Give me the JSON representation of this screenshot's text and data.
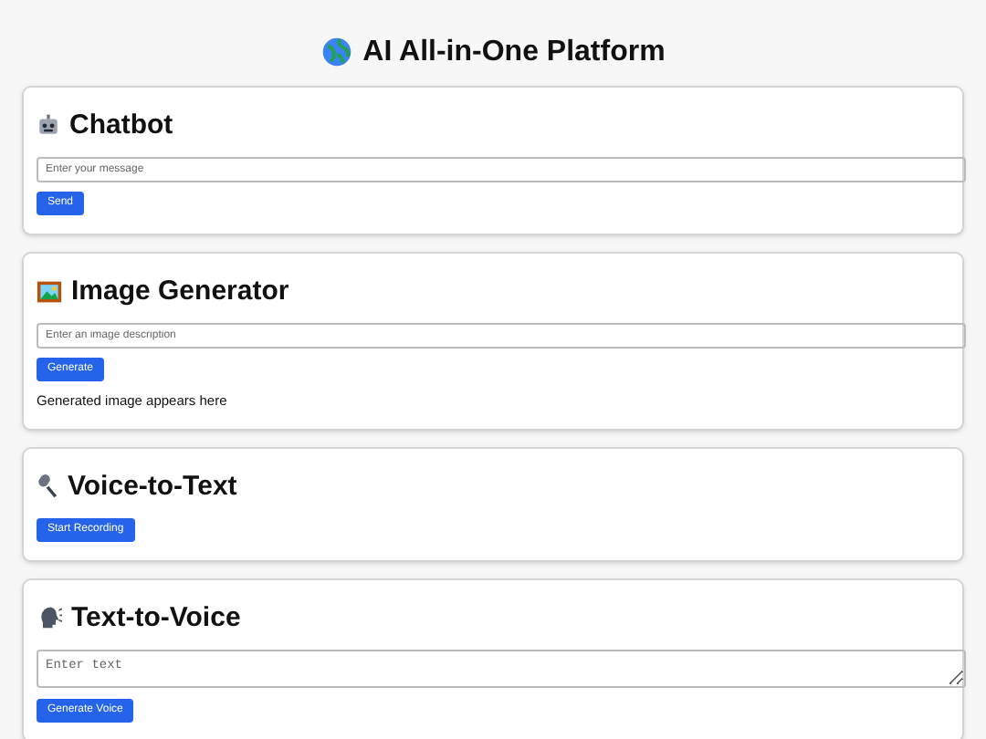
{
  "title": "AI All-in-One Platform",
  "sections": [
    {
      "kind": "chatbot",
      "heading": "Chatbot",
      "field": {
        "kind": "input",
        "placeholder": "Enter your message"
      },
      "button": "Send"
    },
    {
      "kind": "image",
      "heading": "Image Generator",
      "field": {
        "kind": "input",
        "placeholder": "Enter an image description"
      },
      "button": "Generate",
      "output": "Generated image appears here"
    },
    {
      "kind": "voice",
      "heading": "Voice-to-Text",
      "button": "Start Recording"
    },
    {
      "kind": "speech",
      "heading": "Text-to-Voice",
      "field": {
        "kind": "textarea",
        "placeholder": "Enter text"
      },
      "button": "Generate Voice"
    }
  ]
}
